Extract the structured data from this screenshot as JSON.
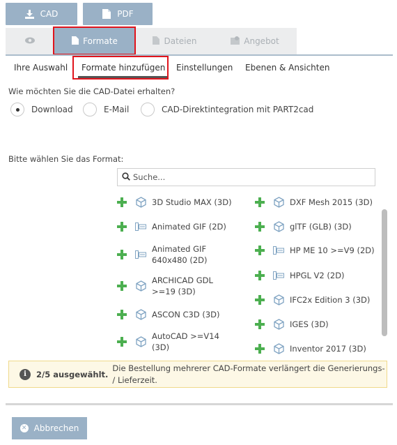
{
  "top_buttons": {
    "cad": "CAD",
    "pdf": "PDF"
  },
  "tabs": {
    "preview_icon": "eye-icon",
    "formate": "Formate",
    "dateien": "Dateien",
    "angebot": "Angebot"
  },
  "subtabs": [
    "Ihre Auswahl",
    "Formate hinzufügen",
    "Einstellungen",
    "Ebenen & Ansichten"
  ],
  "question": "Wie möchten Sie die CAD-Datei erhalten?",
  "delivery_options": [
    {
      "label": "Download",
      "selected": true
    },
    {
      "label": "E-Mail",
      "selected": false
    },
    {
      "label": "CAD-Direktintegration mit PART2cad",
      "selected": false
    }
  ],
  "format_label": "Bitte wählen Sie das Format:",
  "search": {
    "placeholder": "Suche..."
  },
  "formats_left": [
    {
      "label": "3D Studio MAX (3D)",
      "icon": "cube-icon"
    },
    {
      "label": "Animated GIF (2D)",
      "icon": "image-icon"
    },
    {
      "label": "Animated GIF 640x480 (2D)",
      "icon": "image-icon"
    },
    {
      "label": "ARCHICAD GDL >=19 (3D)",
      "icon": "cube-icon"
    },
    {
      "label": "ASCON C3D (3D)",
      "icon": "cube-icon"
    },
    {
      "label": "AutoCAD >=V14 (3D)",
      "icon": "cube-icon"
    }
  ],
  "formats_right": [
    {
      "label": "DXF Mesh 2015 (3D)",
      "icon": "cube-icon"
    },
    {
      "label": "glTF (GLB) (3D)",
      "icon": "cube-icon"
    },
    {
      "label": "HP ME 10 >=V9 (2D)",
      "icon": "drawing-icon"
    },
    {
      "label": "HPGL V2 (2D)",
      "icon": "drawing-icon"
    },
    {
      "label": "IFC2x Edition 3 (3D)",
      "icon": "cube-icon"
    },
    {
      "label": "IGES (3D)",
      "icon": "cube-icon"
    },
    {
      "label": "Inventor 2017 (3D)",
      "icon": "cube-icon"
    }
  ],
  "notice": {
    "count": "2/5 ausgewählt.",
    "message": "Die Bestellung mehrerer CAD-Formate verlängert die Generierungs- / Lieferzeit."
  },
  "cancel": "Abbrechen",
  "colors": {
    "accent": "#9ab1c6",
    "plus": "#4caf50",
    "highlight": "#e0141c",
    "notice_bg": "#fdf8e6"
  }
}
